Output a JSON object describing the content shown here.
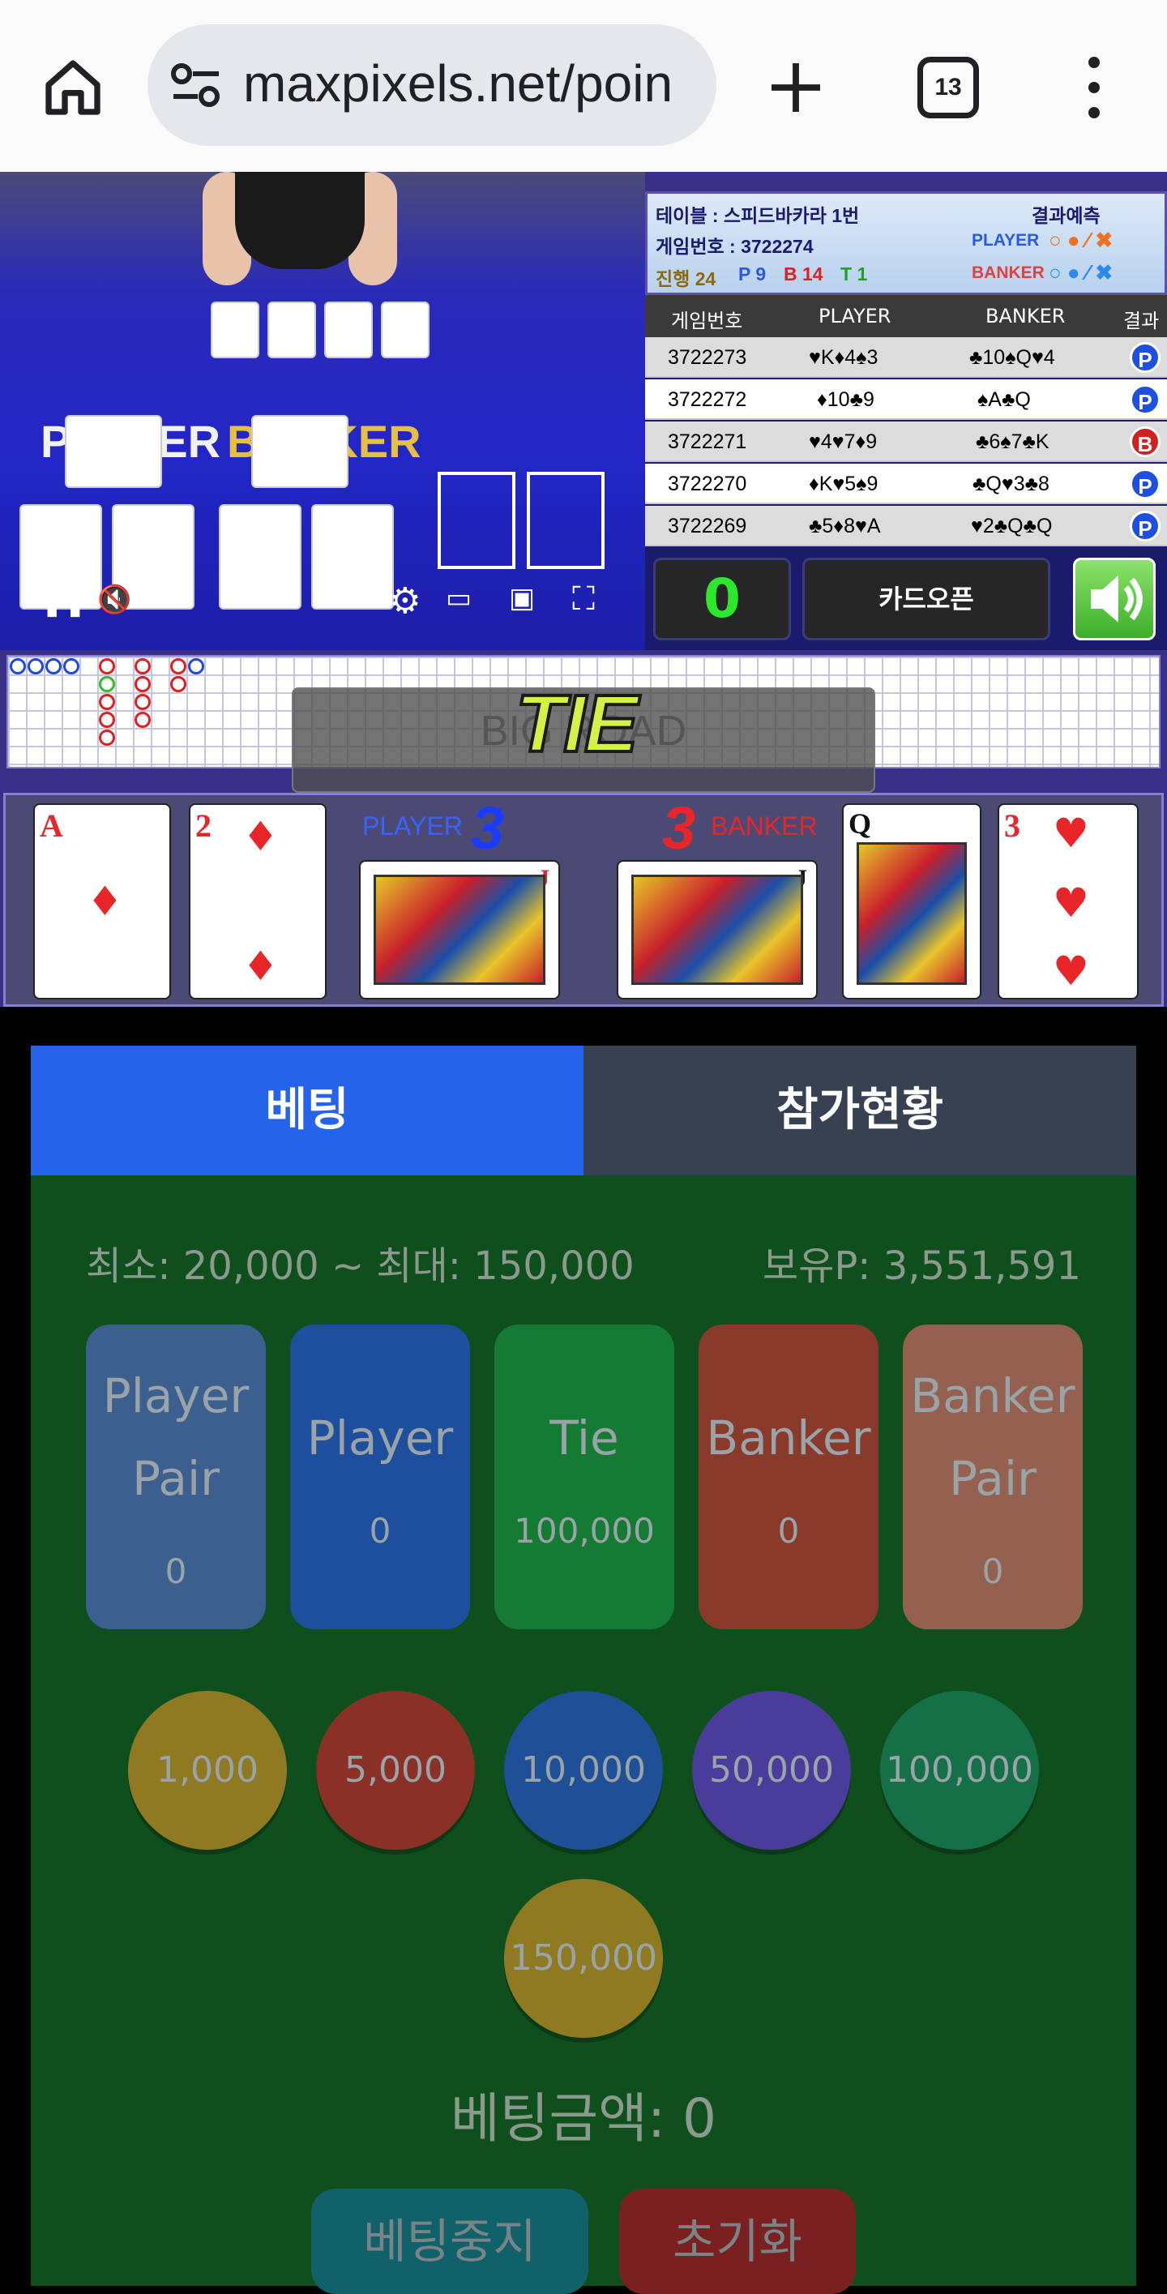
{
  "browser": {
    "url": "maxpixels.net/poin",
    "tab_count": "13"
  },
  "table_info": {
    "table": "테이블 : 스피드바카라 1번",
    "prediction_title": "결과예측",
    "game_no": "게임번호 : 3722274",
    "player_label": "PLAYER",
    "banker_label": "BANKER",
    "progress_label": "진행 24",
    "p_count": "P 9",
    "b_count": "B 14",
    "t_count": "T 1"
  },
  "history": {
    "headers": [
      "게임번호",
      "PLAYER",
      "BANKER",
      "결과"
    ],
    "rows": [
      {
        "game": "3722273",
        "player": "♥K♦4♠3",
        "banker": "♣10♠Q♥4",
        "result": "P"
      },
      {
        "game": "3722272",
        "player": "♦10♣9",
        "banker": "♠A♣Q",
        "result": "P"
      },
      {
        "game": "3722271",
        "player": "♥4♥7♦9",
        "banker": "♣6♠7♣K",
        "result": "B"
      },
      {
        "game": "3722270",
        "player": "♦K♥5♠9",
        "banker": "♣Q♥3♣8",
        "result": "P"
      },
      {
        "game": "3722269",
        "player": "♣5♦8♥A",
        "banker": "♥2♣Q♣Q",
        "result": "P"
      }
    ]
  },
  "controls": {
    "count": "0",
    "card_open": "카드오픈"
  },
  "video": {
    "player_label": "PLAYER",
    "banker_label": "BANKER"
  },
  "road": {
    "title": "BIG ROAD",
    "overlay": "TIE"
  },
  "result": {
    "player_label": "PLAYER",
    "player_score": "3",
    "banker_label": "BANKER",
    "banker_score": "3",
    "cards": [
      "A",
      "2",
      "J",
      "J",
      "Q",
      "3"
    ]
  },
  "betting": {
    "tab_bet": "베팅",
    "tab_status": "참가현황",
    "limits": "최소: 20,000 ~ 최대: 150,000",
    "balance": "보유P: 3,551,591",
    "options": [
      {
        "label_1": "Player",
        "label_2": "Pair",
        "amount": "0",
        "color": "#3b5f8f"
      },
      {
        "label_1": "Player",
        "label_2": "",
        "amount": "0",
        "color": "#1e4f9c"
      },
      {
        "label_1": "Tie",
        "label_2": "",
        "amount": "100,000",
        "color": "#157a33"
      },
      {
        "label_1": "Banker",
        "label_2": "",
        "amount": "0",
        "color": "#8a3a2a"
      },
      {
        "label_1": "Banker",
        "label_2": "Pair",
        "amount": "0",
        "color": "#946050"
      }
    ],
    "chips": [
      "1,000",
      "5,000",
      "10,000",
      "50,000",
      "100,000",
      "150,000"
    ],
    "total": "베팅금액: 0",
    "stop_button": "베팅중지",
    "reset_button": "초기화"
  }
}
